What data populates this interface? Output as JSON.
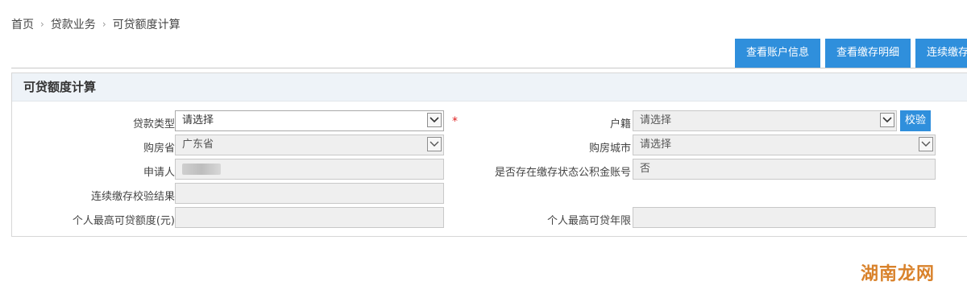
{
  "breadcrumb": {
    "home": "首页",
    "section": "贷款业务",
    "current": "可贷额度计算"
  },
  "toolbar": {
    "view_account": "查看账户信息",
    "view_deposit": "查看缴存明细",
    "continuous": "连续缴存"
  },
  "panel": {
    "title": "可贷额度计算"
  },
  "form": {
    "loan_type_label": "贷款类型",
    "loan_type_value": "请选择",
    "required_mark": "*",
    "hukou_label": "户籍",
    "hukou_value": "请选择",
    "check_button": "校验",
    "province_label": "购房省",
    "province_value": "广东省",
    "city_label": "购房城市",
    "city_value": "请选择",
    "applicant_label": "申请人",
    "fund_account_label": "是否存在缴存状态公积金账号",
    "fund_account_value": "否",
    "continuous_result_label": "连续缴存校验结果",
    "max_amount_label": "个人最高可贷额度(元)",
    "max_term_label": "个人最高可贷年限"
  },
  "watermark": "湖南龙网",
  "colors": {
    "accent": "#2f8fdc",
    "required": "#e02020"
  }
}
